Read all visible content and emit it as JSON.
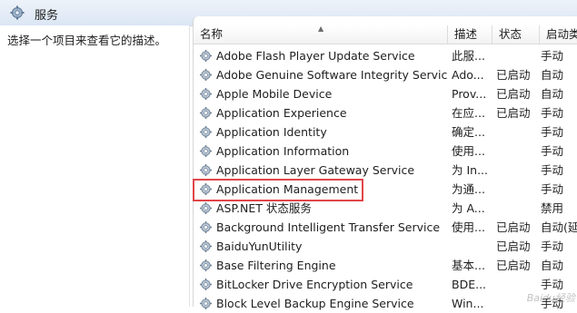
{
  "header": {
    "title": "服务",
    "icon": "services-gear-icon"
  },
  "left_pane": {
    "description": "选择一个项目来查看它的描述。"
  },
  "table": {
    "columns": [
      "名称",
      "描述",
      "状态",
      "启动类型"
    ],
    "sorted_column": "名称",
    "rows": [
      {
        "name": "Adobe Flash Player Update Service",
        "desc": "此服...",
        "status": "",
        "startup": "手动"
      },
      {
        "name": "Adobe Genuine Software Integrity Service",
        "desc": "Ado...",
        "status": "已启动",
        "startup": "自动"
      },
      {
        "name": "Apple Mobile Device",
        "desc": "Prov...",
        "status": "已启动",
        "startup": "自动"
      },
      {
        "name": "Application Experience",
        "desc": "在应...",
        "status": "已启动",
        "startup": "手动"
      },
      {
        "name": "Application Identity",
        "desc": "确定...",
        "status": "",
        "startup": "手动"
      },
      {
        "name": "Application Information",
        "desc": "使用...",
        "status": "",
        "startup": "手动"
      },
      {
        "name": "Application Layer Gateway Service",
        "desc": "为 In...",
        "status": "",
        "startup": "手动"
      },
      {
        "name": "Application Management",
        "desc": "为通...",
        "status": "",
        "startup": "手动"
      },
      {
        "name": "ASP.NET 状态服务",
        "desc": "为 A...",
        "status": "",
        "startup": "禁用"
      },
      {
        "name": "Background Intelligent Transfer Service",
        "desc": "使用...",
        "status": "已启动",
        "startup": "自动(延"
      },
      {
        "name": "BaiduYunUtility",
        "desc": "",
        "status": "已启动",
        "startup": "手动"
      },
      {
        "name": "Base Filtering Engine",
        "desc": "基本...",
        "status": "已启动",
        "startup": "自动"
      },
      {
        "name": "BitLocker Drive Encryption Service",
        "desc": "BDE...",
        "status": "",
        "startup": "手动"
      },
      {
        "name": "Block Level Backup Engine Service",
        "desc": "Win...",
        "status": "",
        "startup": "手动"
      }
    ],
    "highlighted_row": "Application Management"
  },
  "watermark": "Baidu经验"
}
